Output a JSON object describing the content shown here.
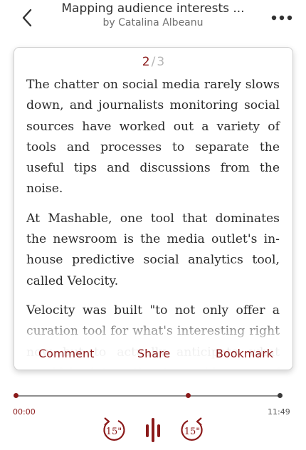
{
  "header": {
    "title": "Mapping audience interests ...",
    "subtitle": "by Catalina Albeanu",
    "back_icon": "chevron-left-icon",
    "more_icon": "more-horizontal-icon"
  },
  "pager": {
    "current": "2",
    "separator": "/",
    "total": "3"
  },
  "article": {
    "paragraphs": [
      "The chatter on social media rarely slows down, and journalists monitoring social sources have worked out a variety of tools and processes to separate the useful tips and discussions from the noise.",
      "At Mashable, one tool that dominates the newsroom is the media outlet's in-house predictive social analytics tool, called Velocity.",
      "Velocity was built \"to not only offer a curation tool for what's interesting right now but to actually anticipate what would be interesting to a wide array of readers,\" Haley Cheung, chief Marc, explained in"
    ]
  },
  "actions": {
    "comment": "Comment",
    "share": "Share",
    "bookmark": "Bookmark"
  },
  "player": {
    "elapsed": "00:00",
    "duration": "11:49",
    "rewind_label": "15\"",
    "forward_label": "15\"",
    "accent_color": "#8b1a1a",
    "icons": [
      "rewind-15-icon",
      "audio-bars-icon",
      "forward-15-icon"
    ]
  }
}
